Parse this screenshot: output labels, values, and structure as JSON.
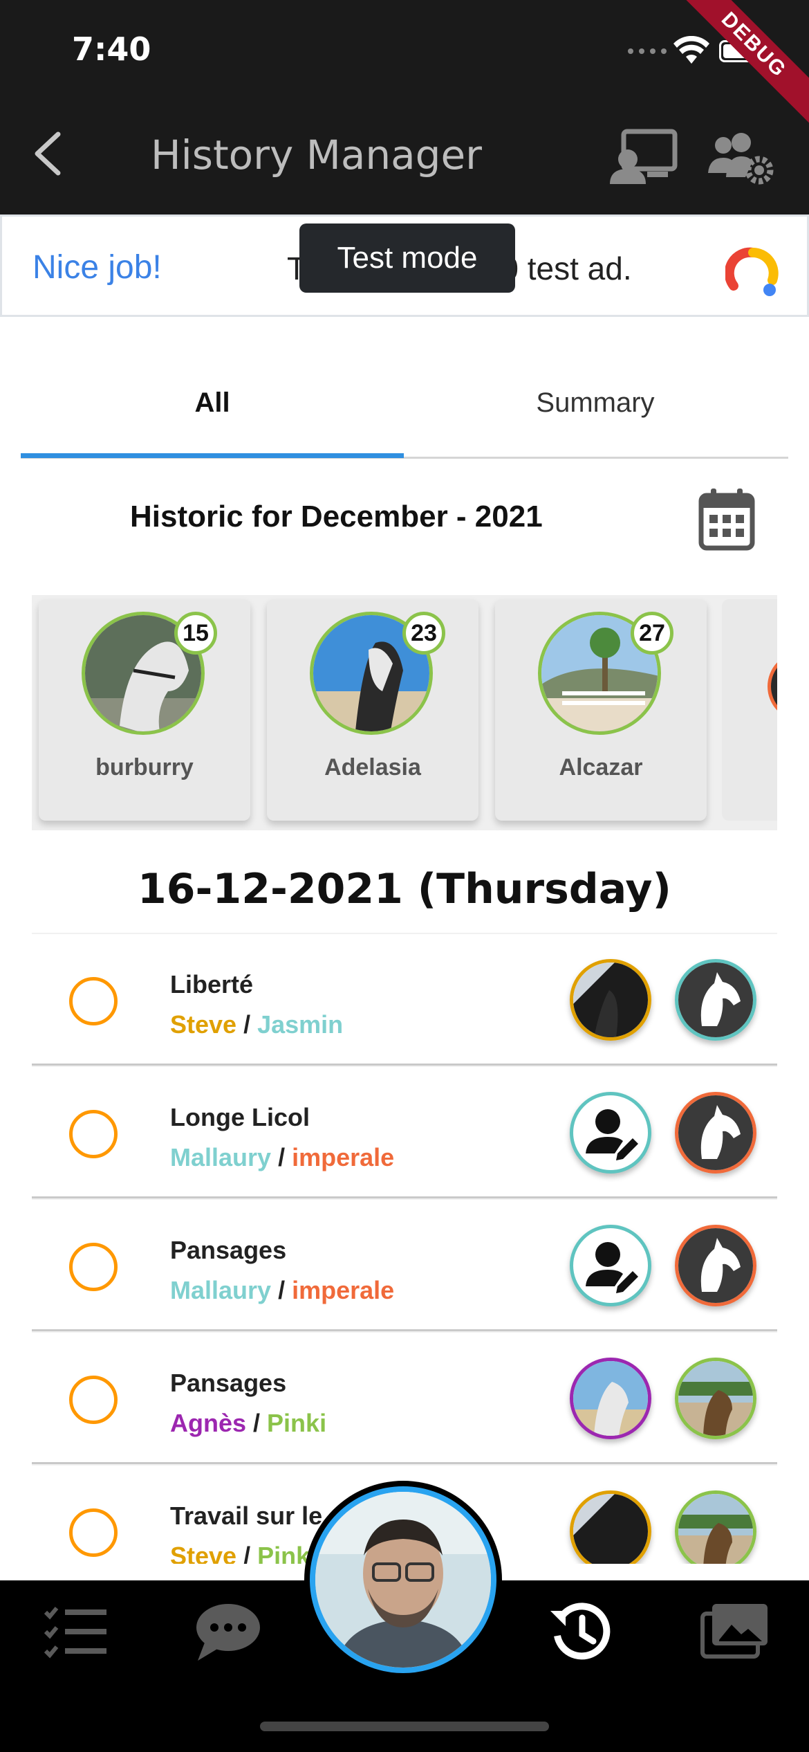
{
  "status": {
    "time": "7:40",
    "debug_label": "DEBUG"
  },
  "appbar": {
    "title": "History Manager"
  },
  "ad": {
    "nice": "Nice job!",
    "text": "This is a 320x50 test ad.",
    "tooltip": "Test mode"
  },
  "tabs": [
    {
      "label": "All",
      "selected": true
    },
    {
      "label": "Summary",
      "selected": false
    }
  ],
  "historic": {
    "label": "Historic for December - 2021"
  },
  "horses": [
    {
      "name": "burburry",
      "count": "15"
    },
    {
      "name": "Adelasia",
      "count": "23"
    },
    {
      "name": "Alcazar",
      "count": "27"
    }
  ],
  "date_heading": "16-12-2021 (Thursday)",
  "events": [
    {
      "title": "Liberté",
      "person": "Steve",
      "horse": "Jasmin",
      "person_color": "#e0a000",
      "horse_color": "#7fd0cf"
    },
    {
      "title": "Longe Licol",
      "person": "Mallaury",
      "horse": "imperale",
      "person_color": "#7fd0cf",
      "horse_color": "#f06a3a"
    },
    {
      "title": "Pansages",
      "person": "Mallaury",
      "horse": "imperale",
      "person_color": "#7fd0cf",
      "horse_color": "#f06a3a"
    },
    {
      "title": "Pansages",
      "person": "Agnès ",
      "horse": "Pinki",
      "person_color": "#9c27b0",
      "horse_color": "#8bc34a"
    },
    {
      "title": "Travail sur le",
      "person": "Steve",
      "horse": "Pinki",
      "person_color": "#e0a000",
      "horse_color": "#8bc34a"
    }
  ],
  "separator": " / ",
  "colors": {
    "tab_indicator": "#2f8fe0",
    "fab_ring": "#29a3f0",
    "check_ring": "#ff9800",
    "card_ring": "#8bc34a"
  },
  "bottom_nav": {
    "items": [
      "checklist-icon",
      "chat-icon",
      "history-icon",
      "gallery-icon"
    ],
    "active": "history-icon"
  }
}
